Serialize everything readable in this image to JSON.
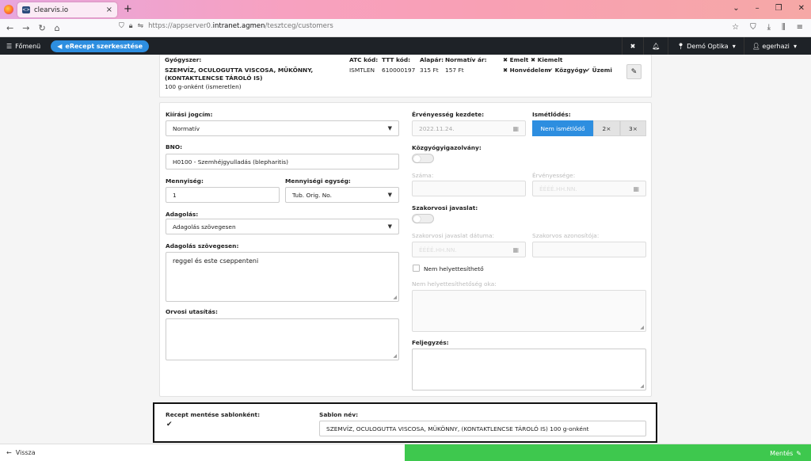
{
  "browser": {
    "tab_title": "clearvis.io",
    "url_prefix": "https://appserver0.",
    "url_domain": "intranet.agmen",
    "url_path": "/tesztceg/customers"
  },
  "appbar": {
    "menu_label": "Főmenü",
    "erecept_label": "eRecept szerkesztése",
    "location": "Demó Optika",
    "user": "egerhazi"
  },
  "drug": {
    "label_drug": "Gyógyszer:",
    "name": "SZEMVÍZ, OCULOGUTTA VISCOSA, MÜKÖNNY, (KONTAKTLENCSE TÁROLÓ IS)",
    "package": "100 g-onként (ismeretlen)",
    "label_atc": "ATC kód:",
    "atc": "ISMTLEN",
    "label_ttt": "TTT kód:",
    "ttt": "610000197",
    "label_base": "Alapár:",
    "base_price": "315 Ft",
    "label_normal": "Normatív ár:",
    "normal_price": "157 Ft",
    "flag_emelt": "Emelt",
    "flag_kiemelt": "Kiemelt",
    "flag_honvedelem": "Honvédelem",
    "flag_kozgyogy": "Közgyógy",
    "flag_uzemi": "Üzemi"
  },
  "form": {
    "kiirasi_label": "Kiírási jogcím:",
    "kiirasi_value": "Normatív",
    "bno_label": "BNO:",
    "bno_value": "H0100 - Szemhéjgyulladás (blepharitis)",
    "mennyiseg_label": "Mennyiség:",
    "mennyiseg_value": "1",
    "egyseg_label": "Mennyiségi egység:",
    "egyseg_value": "Tub. Orig. No.",
    "adagolas_label": "Adagolás:",
    "adagolas_value": "Adagolás szövegesen",
    "adagolas_szoveg_label": "Adagolás szövegesen:",
    "adagolas_szoveg_value": "reggel és este cseppenteni",
    "orvosi_label": "Orvosi utasítás:",
    "ervenyesseg_label": "Érvényesség kezdete:",
    "ervenyesseg_value": "2022.11.24.",
    "ismetles_label": "Ismétlődés:",
    "ismetles_options": [
      "Nem ismétlődő",
      "2×",
      "3×"
    ],
    "kozgyogy_label": "Közgyógyigazolvány:",
    "szama_label": "Száma:",
    "kozgyogy_erv_label": "Érvényessége:",
    "kozgyogy_erv_placeholder": "ÉÉÉÉ.HH.NN.",
    "szakorvosi_label": "Szakorvosi javaslat:",
    "szakorvosi_datum_label": "Szakorvosi javaslat dátuma:",
    "szakorvosi_datum_placeholder": "ÉÉÉÉ.HH.NN.",
    "szakorvos_azon_label": "Szakorvos azonosítója:",
    "nem_helyettesitheto_label": "Nem helyettesíthető",
    "nem_helyettesitheto_ok_label": "Nem helyettesíthetőség oka:",
    "feljegyzes_label": "Feljegyzés:"
  },
  "template": {
    "save_label": "Recept mentése sablonként:",
    "name_label": "Sablon név:",
    "name_value": "SZEMVÍZ, OCULOGUTTA VISCOSA, MÜKÖNNY, (KONTAKTLENCSE TÁROLÓ IS) 100 g-onként"
  },
  "footer": {
    "back_label": "Vissza",
    "save_label": "Mentés"
  },
  "colors": {
    "primary": "#2d8ee0",
    "save_green": "#3ec84e",
    "appbar": "#1e2227"
  }
}
